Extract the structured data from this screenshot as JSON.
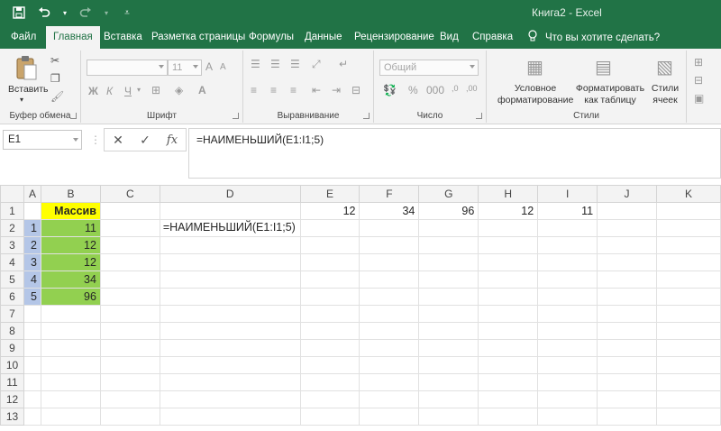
{
  "window": {
    "title": "Книга2  -  Excel"
  },
  "qat": {
    "save": "save-icon",
    "undo": "undo-icon",
    "redo": "redo-icon",
    "customize": "chevron-down-icon"
  },
  "tabs": [
    "Файл",
    "Главная",
    "Вставка",
    "Разметка страницы",
    "Формулы",
    "Данные",
    "Рецензирование",
    "Вид",
    "Справка"
  ],
  "tell_me": "Что вы хотите сделать?",
  "ribbon": {
    "clipboard": {
      "paste": "Вставить",
      "label": "Буфер обмена"
    },
    "font": {
      "size": "11",
      "bold": "Ж",
      "italic": "К",
      "underline": "Ч",
      "label": "Шрифт"
    },
    "alignment": {
      "label": "Выравнивание"
    },
    "number": {
      "format": "Общий",
      "label": "Число"
    },
    "styles": {
      "conditional": "Условное форматирование",
      "as_table": "Форматировать как таблицу",
      "cell_styles": "Стили ячеек",
      "label": "Стили"
    }
  },
  "formula_bar": {
    "name_box": "E1",
    "fx": "fx",
    "formula": "=НАИМЕНЬШИЙ(E1:I1;5)"
  },
  "sheet": {
    "columns": [
      "A",
      "B",
      "C",
      "D",
      "E",
      "F",
      "G",
      "H",
      "I",
      "J",
      "K"
    ],
    "rows": [
      "1",
      "2",
      "3",
      "4",
      "5",
      "6",
      "7",
      "8",
      "9",
      "10",
      "11",
      "12",
      "13"
    ],
    "header_b1": "Массив",
    "a": [
      "1",
      "2",
      "3",
      "4",
      "5"
    ],
    "b": [
      "11",
      "12",
      "12",
      "34",
      "96"
    ],
    "d2": "=НАИМЕНЬШИЙ(E1:I1;5)",
    "row1": {
      "E": "12",
      "F": "34",
      "G": "96",
      "H": "12",
      "I": "11"
    }
  },
  "colors": {
    "brand": "#217346",
    "header_fill": "#ffff00",
    "green_fill": "#92d050",
    "blue_fill": "#b4c6e7"
  }
}
